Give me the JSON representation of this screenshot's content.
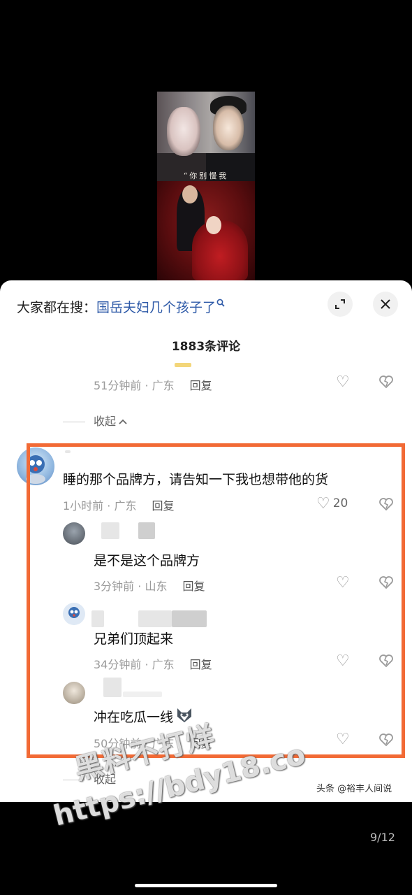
{
  "search": {
    "prefix": "大家都在搜：",
    "term": "国岳夫妇几个孩子了"
  },
  "image_caption": "“你别慢我",
  "comment_count": "1883条评论",
  "prev_reply": {
    "time": "51分钟前 · 广东",
    "reply": "回复"
  },
  "collapse_top": "收起",
  "main_comment": {
    "text": "睡的那个品牌方，请告知一下我也想带他的货",
    "time": "1小时前 · 广东",
    "reply": "回复",
    "likes": "20"
  },
  "replies": [
    {
      "text": "是不是这个品牌方",
      "time": "3分钟前 · 山东",
      "reply": "回复"
    },
    {
      "text": "兄弟们顶起来",
      "time": "34分钟前 · 广东",
      "reply": "回复"
    },
    {
      "text": "冲在吃瓜一线",
      "time": "50分钟前 · 广东",
      "reply": "回复"
    }
  ],
  "collapse_bottom": "收起",
  "source": "头条 @裕丰人间说",
  "watermark": {
    "line1": "黑料不打烊",
    "line2": "https://bdy18.co"
  },
  "pager": "9/12",
  "colors": {
    "highlight": "#f26a35",
    "link": "#2e5aa8"
  }
}
